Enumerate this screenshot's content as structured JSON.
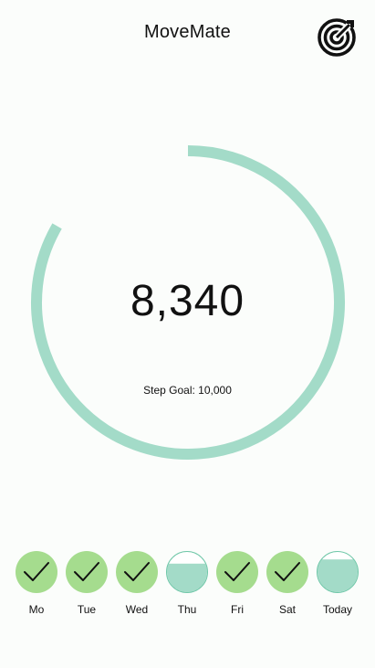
{
  "header": {
    "title": "MoveMate",
    "goal_icon": "target-icon"
  },
  "progress": {
    "steps_display": "8,340",
    "steps": 8340,
    "goal": 10000,
    "goal_label": "Step Goal: 10,000",
    "fraction": 0.834
  },
  "week": {
    "days": [
      {
        "label": "Mo",
        "status": "completed",
        "icon": "check-icon"
      },
      {
        "label": "Tue",
        "status": "completed",
        "icon": "check-icon"
      },
      {
        "label": "Wed",
        "status": "completed",
        "icon": "check-icon"
      },
      {
        "label": "Thu",
        "status": "partial",
        "fill": 0.7
      },
      {
        "label": "Fri",
        "status": "completed",
        "icon": "check-icon"
      },
      {
        "label": "Sat",
        "status": "completed",
        "icon": "check-icon"
      },
      {
        "label": "Today",
        "status": "partial",
        "fill": 0.8
      }
    ]
  },
  "colors": {
    "ring": "#a3dbc8",
    "completed": "#a5dc8e",
    "partial_fill": "#a3dbc8",
    "partial_outline": "#6fc7a8",
    "background": "#fbfdfb"
  }
}
